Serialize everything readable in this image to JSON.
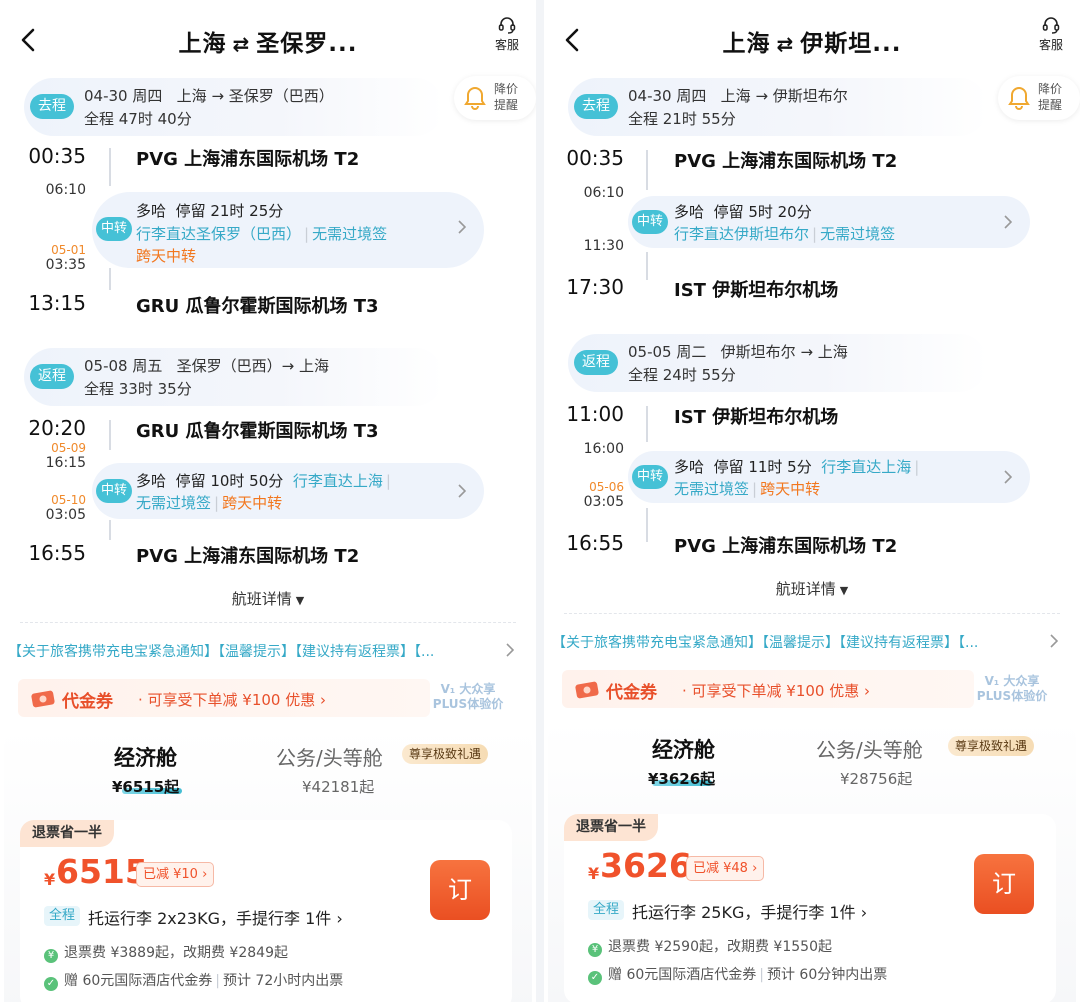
{
  "panels": [
    {
      "header": {
        "from": "上海",
        "swap": "⇄",
        "to": "圣保罗...",
        "service_label": "客服"
      },
      "price_alert": {
        "label": "降价提醒"
      },
      "outbound": {
        "tag": "去程",
        "date": "04-30 周四",
        "route": "上海 → 圣保罗（巴西）",
        "duration": "全程 47时 40分",
        "dep_time": "00:35",
        "dep_airport": "PVG 上海浦东国际机场 T2",
        "transfer": {
          "arrive_time": "06:10",
          "arrive_date": "",
          "leave_date": "05-01",
          "leave_time": "03:35",
          "tag": "中转",
          "city": "多哈",
          "stay": "停留 21时 25分",
          "note1": "行李直达圣保罗（巴西）",
          "note2": "无需过境签",
          "note3": "跨天中转"
        },
        "arr_time": "13:15",
        "arr_airport": "GRU 瓜鲁尔霍斯国际机场 T3"
      },
      "return": {
        "tag": "返程",
        "date": "05-08 周五",
        "route": "圣保罗（巴西）→ 上海",
        "duration": "全程 33时 35分",
        "dep_time": "20:20",
        "dep_airport": "GRU 瓜鲁尔霍斯国际机场 T3",
        "transfer": {
          "arrive_date": "05-09",
          "arrive_time": "16:15",
          "leave_date": "05-10",
          "leave_time": "03:05",
          "tag": "中转",
          "city": "多哈",
          "stay": "停留 10时 50分",
          "note1": "行李直达上海",
          "note2": "无需过境签",
          "note3": "跨天中转"
        },
        "arr_time": "16:55",
        "arr_airport": "PVG 上海浦东国际机场 T2"
      },
      "detail_label": "航班详情",
      "notice": "【关于旅客携带充电宝紧急通知】【温馨提示】【建议持有返程票】【...",
      "coupon": {
        "name": "代金券",
        "desc": "· 可享受下单减 ¥100 优惠  ›"
      },
      "plus": {
        "line1": "V₁ 大众享",
        "line2": "PLUS体验价"
      },
      "cabins": {
        "economy": "经济舱",
        "economy_price": "¥6515起",
        "business": "公务/头等舱",
        "business_badge": "尊享极致礼遇",
        "business_price": "¥42181起"
      },
      "fare": {
        "tag": "退票省一半",
        "yen": "¥",
        "price": "6515",
        "discount": "已减 ¥10 ›",
        "book": "订",
        "full": "全程",
        "baggage": "托运行李 2x23KG，手提行李 1件 ›",
        "refund": "退票费 ¥3889起，改期费 ¥2849起",
        "gift": "赠 60元国际酒店代金券",
        "ticketing": "预计 72小时内出票"
      }
    },
    {
      "header": {
        "from": "上海",
        "swap": "⇄",
        "to": "伊斯坦...",
        "service_label": "客服"
      },
      "price_alert": {
        "label": "降价提醒"
      },
      "outbound": {
        "tag": "去程",
        "date": "04-30 周四",
        "route": "上海 → 伊斯坦布尔",
        "duration": "全程 21时 55分",
        "dep_time": "00:35",
        "dep_airport": "PVG 上海浦东国际机场 T2",
        "transfer": {
          "arrive_time": "06:10",
          "arrive_date": "",
          "leave_date": "",
          "leave_time": "11:30",
          "tag": "中转",
          "city": "多哈",
          "stay": "停留 5时 20分",
          "note1": "行李直达伊斯坦布尔",
          "note2": "无需过境签",
          "note3": ""
        },
        "arr_time": "17:30",
        "arr_airport": "IST 伊斯坦布尔机场"
      },
      "return": {
        "tag": "返程",
        "date": "05-05 周二",
        "route": "伊斯坦布尔 → 上海",
        "duration": "全程 24时 55分",
        "dep_time": "11:00",
        "dep_airport": "IST 伊斯坦布尔机场",
        "transfer": {
          "arrive_date": "",
          "arrive_time": "16:00",
          "leave_date": "05-06",
          "leave_time": "03:05",
          "tag": "中转",
          "city": "多哈",
          "stay": "停留 11时 5分",
          "note1": "行李直达上海",
          "note2": "无需过境签",
          "note3": "跨天中转"
        },
        "arr_time": "16:55",
        "arr_airport": "PVG 上海浦东国际机场 T2"
      },
      "detail_label": "航班详情",
      "notice": "【关于旅客携带充电宝紧急通知】【温馨提示】【建议持有返程票】【...",
      "coupon": {
        "name": "代金券",
        "desc": "· 可享受下单减 ¥100 优惠  ›"
      },
      "plus": {
        "line1": "V₁ 大众享",
        "line2": "PLUS体验价"
      },
      "cabins": {
        "economy": "经济舱",
        "economy_price": "¥3626起",
        "business": "公务/头等舱",
        "business_badge": "尊享极致礼遇",
        "business_price": "¥28756起"
      },
      "fare": {
        "tag": "退票省一半",
        "yen": "¥",
        "price": "3626",
        "discount": "已减 ¥48 ›",
        "book": "订",
        "full": "全程",
        "baggage": "托运行李 25KG，手提行李 1件 ›",
        "refund": "退票费 ¥2590起，改期费 ¥1550起",
        "gift": "赠 60元国际酒店代金券",
        "ticketing": "预计 60分钟内出票"
      }
    }
  ],
  "colors": {
    "accent": "#45c1d6",
    "link": "#36a9c7",
    "warn": "#f2771e",
    "price": "#f0522b"
  }
}
